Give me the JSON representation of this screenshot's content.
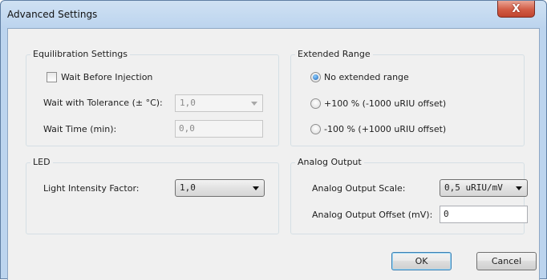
{
  "window": {
    "title": "Advanced Settings",
    "close_glyph": "X"
  },
  "equilibration": {
    "title": "Equilibration Settings",
    "wait_before_label": "Wait Before Injection",
    "wait_before_checked": false,
    "tolerance_label": "Wait with Tolerance (± °C):",
    "tolerance_value": "1,0",
    "wait_time_label": "Wait Time (min):",
    "wait_time_value": "0,0"
  },
  "extended_range": {
    "title": "Extended Range",
    "options": [
      {
        "label": "No extended range",
        "checked": true
      },
      {
        "label": "+100 % (-1000 uRIU offset)",
        "checked": false
      },
      {
        "label": "-100 % (+1000 uRIU offset)",
        "checked": false
      }
    ]
  },
  "led": {
    "title": "LED",
    "intensity_label": "Light Intensity Factor:",
    "intensity_value": "1,0"
  },
  "analog_output": {
    "title": "Analog Output",
    "scale_label": "Analog Output Scale:",
    "scale_value": "0,5 uRIU/mV",
    "offset_label": "Analog Output Offset (mV):",
    "offset_value": "0"
  },
  "buttons": {
    "ok": "OK",
    "cancel": "Cancel"
  }
}
